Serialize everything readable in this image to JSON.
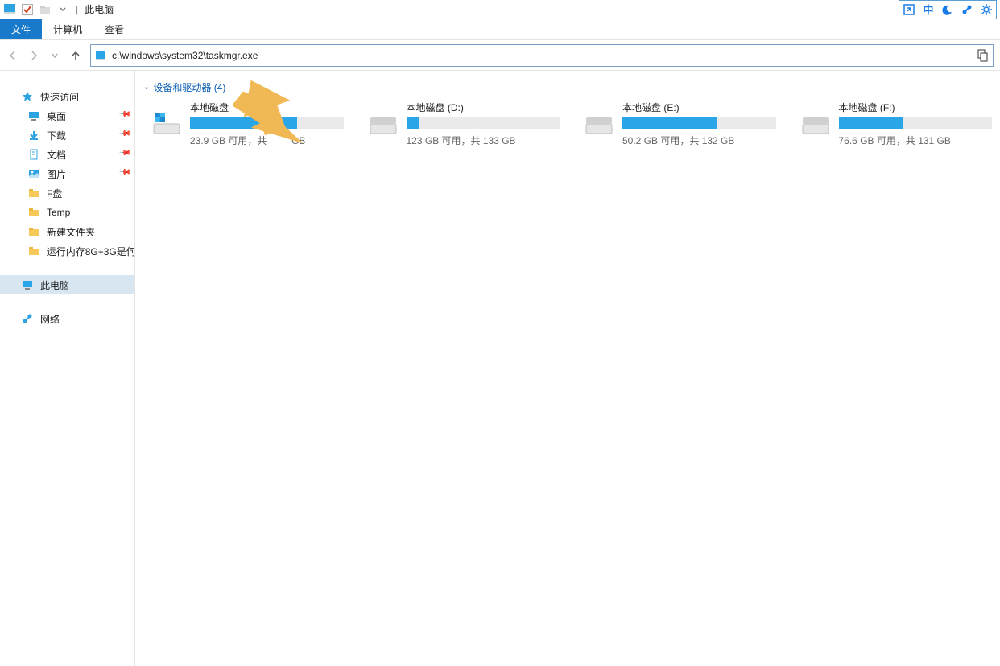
{
  "window": {
    "title": "此电脑"
  },
  "ribbon": {
    "file": "文件",
    "computer": "计算机",
    "view": "查看"
  },
  "address": {
    "path": "c:\\windows\\system32\\taskmgr.exe"
  },
  "right_icons": {
    "a": "expand-icon",
    "b": "中",
    "c": "moon-icon",
    "d": "link-icon",
    "e": "gear-icon"
  },
  "sidebar": {
    "quick_access": "快速访问",
    "pinned": [
      {
        "label": "桌面",
        "icon": "desktop-icon"
      },
      {
        "label": "下载",
        "icon": "download-icon"
      },
      {
        "label": "文档",
        "icon": "document-icon"
      },
      {
        "label": "图片",
        "icon": "pictures-icon"
      }
    ],
    "folders": [
      {
        "label": "F盘",
        "icon": "folder-icon"
      },
      {
        "label": "Temp",
        "icon": "folder-icon"
      },
      {
        "label": "新建文件夹",
        "icon": "folder-icon"
      },
      {
        "label": "运行内存8G+3G是何",
        "icon": "folder-icon"
      }
    ],
    "this_pc": "此电脑",
    "network": "网络"
  },
  "content": {
    "section_header": "设备和驱动器 (4)",
    "drives": [
      {
        "name": "本地磁盘",
        "free": "23.9 GB 可用，共",
        "total_suffix": "GB",
        "fill_percent": 70
      },
      {
        "name": "本地磁盘 (D:)",
        "free": "123 GB 可用，共 133 GB",
        "total_suffix": "",
        "fill_percent": 8
      },
      {
        "name": "本地磁盘 (E:)",
        "free": "50.2 GB 可用，共 132 GB",
        "total_suffix": "",
        "fill_percent": 62
      },
      {
        "name": "本地磁盘 (F:)",
        "free": "76.6 GB 可用，共 131 GB",
        "total_suffix": "",
        "fill_percent": 42
      }
    ]
  }
}
